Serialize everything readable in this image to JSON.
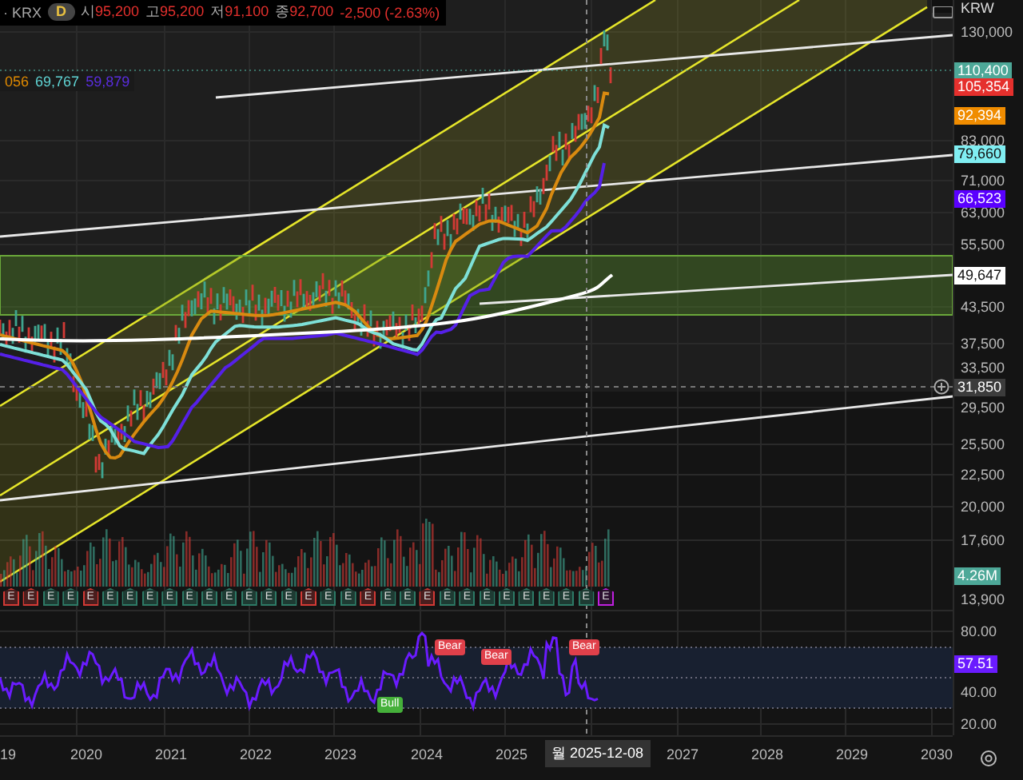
{
  "header": {
    "exchange": "· KRX",
    "interval": "D",
    "ohlc": [
      {
        "label": "시",
        "value": "95,200"
      },
      {
        "label": "고",
        "value": "95,200"
      },
      {
        "label": "저",
        "value": "91,100"
      },
      {
        "label": "종",
        "value": "92,700"
      }
    ],
    "change": "-2,500 (-2.63%)"
  },
  "ma_legend": [
    {
      "value": "056",
      "color": "#e08a00"
    },
    {
      "value": "69,767",
      "color": "#5fd3d3"
    },
    {
      "value": "59,879",
      "color": "#5a2de0"
    }
  ],
  "currency": "KRW",
  "price_axis": {
    "ticks": [
      "130,000",
      "83,000",
      "71,000",
      "63,000",
      "55,500",
      "43,500",
      "37,500",
      "33,500",
      "29,500",
      "25,500",
      "22,500",
      "20,000",
      "17,600"
    ],
    "badges": [
      {
        "value": "110,400",
        "color": "#4da898"
      },
      {
        "value": "105,354",
        "color": "#e5302d"
      },
      {
        "value": "92,394",
        "color": "#f08c00"
      },
      {
        "value": "79,660",
        "color": "#80eef2"
      },
      {
        "value": "66,523",
        "color": "#5a00ff"
      },
      {
        "value": "49,647",
        "color": "#ffffff"
      },
      {
        "value": "31,850",
        "color": "#3c3c3c"
      }
    ]
  },
  "volume": {
    "badge": {
      "value": "4.26M",
      "color": "#4da898"
    },
    "tick": "13,900"
  },
  "earnings": [
    {
      "label": "E",
      "kind": "miss"
    },
    {
      "label": "E",
      "kind": "miss"
    },
    {
      "label": "E",
      "kind": "beat"
    },
    {
      "label": "E",
      "kind": "beat"
    },
    {
      "label": "E",
      "kind": "miss"
    },
    {
      "label": "E",
      "kind": "beat"
    },
    {
      "label": "E",
      "kind": "beat"
    },
    {
      "label": "E",
      "kind": "beat"
    },
    {
      "label": "E",
      "kind": "beat"
    },
    {
      "label": "E",
      "kind": "beat"
    },
    {
      "label": "E",
      "kind": "beat"
    },
    {
      "label": "E",
      "kind": "beat"
    },
    {
      "label": "E",
      "kind": "beat"
    },
    {
      "label": "E",
      "kind": "beat"
    },
    {
      "label": "E",
      "kind": "beat"
    },
    {
      "label": "E",
      "kind": "miss"
    },
    {
      "label": "E",
      "kind": "beat"
    },
    {
      "label": "E",
      "kind": "beat"
    },
    {
      "label": "E",
      "kind": "miss"
    },
    {
      "label": "E",
      "kind": "beat"
    },
    {
      "label": "E",
      "kind": "beat"
    },
    {
      "label": "E",
      "kind": "miss"
    },
    {
      "label": "E",
      "kind": "beat"
    },
    {
      "label": "E",
      "kind": "beat"
    },
    {
      "label": "E",
      "kind": "beat"
    },
    {
      "label": "E",
      "kind": "beat"
    },
    {
      "label": "E",
      "kind": "beat"
    },
    {
      "label": "E",
      "kind": "beat"
    },
    {
      "label": "E",
      "kind": "beat"
    },
    {
      "label": "E",
      "kind": "beat"
    },
    {
      "label": "E",
      "kind": "upcoming"
    }
  ],
  "rsi": {
    "ticks": [
      "80.00",
      "40.00",
      "20.00"
    ],
    "badge": {
      "value": "57.51",
      "color": "#6a1bff"
    },
    "signals": [
      {
        "label": "Bull",
        "kind": "bull"
      },
      {
        "label": "Bear",
        "kind": "bear"
      },
      {
        "label": "Bear",
        "kind": "bear"
      },
      {
        "label": "Bear",
        "kind": "bear"
      }
    ]
  },
  "time_axis": {
    "labels": [
      "19",
      "2020",
      "2021",
      "2022",
      "2023",
      "2024",
      "2025",
      "2027",
      "2028",
      "2029",
      "2030"
    ],
    "cursor": "월 2025-12-08"
  }
}
